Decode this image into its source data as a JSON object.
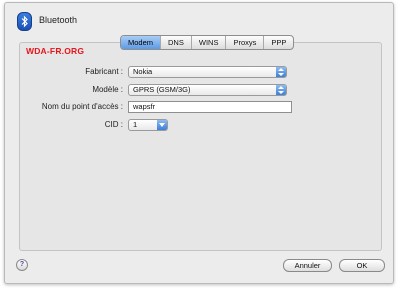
{
  "window": {
    "title": "Bluetooth"
  },
  "icons": {
    "title_icon": "bluetooth-icon",
    "help": "question-mark-icon",
    "popup_arrow": "up-down-arrows-icon"
  },
  "tabs": [
    {
      "label": "Modem",
      "active": true
    },
    {
      "label": "DNS",
      "active": false
    },
    {
      "label": "WINS",
      "active": false
    },
    {
      "label": "Proxys",
      "active": false
    },
    {
      "label": "PPP",
      "active": false
    }
  ],
  "watermark": "WDA-FR.ORG",
  "form": {
    "manufacturer": {
      "label": "Fabricant :",
      "value": "Nokia"
    },
    "model": {
      "label": "Modèle :",
      "value": "GPRS (GSM/3G)"
    },
    "apn": {
      "label": "Nom du point d'accès :",
      "value": "wapsfr"
    },
    "cid": {
      "label": "CID :",
      "value": "1"
    }
  },
  "help_glyph": "?",
  "buttons": {
    "cancel": "Annuler",
    "ok": "OK"
  },
  "colors": {
    "active_tab": "#5d9be5",
    "watermark": "#e8141b"
  }
}
